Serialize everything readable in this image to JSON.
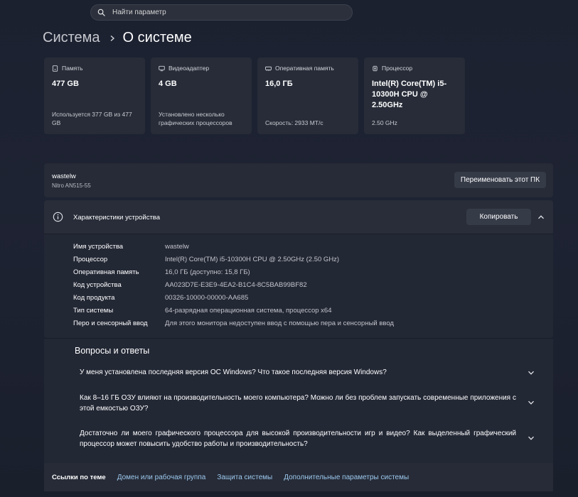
{
  "search": {
    "placeholder": "Найти параметр"
  },
  "breadcrumb": {
    "parent": "Система",
    "current": "О системе"
  },
  "cards": [
    {
      "icon": "storage-icon",
      "title": "Память",
      "value": "477 GB",
      "subtitle": "Используется 377 GB из 477 GB"
    },
    {
      "icon": "display-adapter-icon",
      "title": "Видеоадаптер",
      "value": "4 GB",
      "subtitle": "Установлено несколько графических процессоров"
    },
    {
      "icon": "ram-icon",
      "title": "Оперативная память",
      "value": "16,0 ГБ",
      "subtitle": "Скорость: 2933 МТ/с"
    },
    {
      "icon": "processor-icon",
      "title": "Процессор",
      "value": "Intel(R) Core(TM) i5-10300H CPU @ 2.50GHz",
      "subtitle": "2.50 GHz"
    }
  ],
  "device": {
    "name": "wastelw",
    "model": "Nitro AN515-55",
    "rename_label": "Переименовать этот ПК"
  },
  "specs": {
    "title": "Характеристики устройства",
    "copy_label": "Копировать",
    "rows": [
      {
        "label": "Имя устройства",
        "value": "wastelw"
      },
      {
        "label": "Процессор",
        "value": "Intel(R) Core(TM) i5-10300H CPU @ 2.50GHz (2.50 GHz)"
      },
      {
        "label": "Оперативная память",
        "value": "16,0 ГБ (доступно: 15,8 ГБ)"
      },
      {
        "label": "Код устройства",
        "value": "AA023D7E-E3E9-4EA2-B1C4-8C5BAB99BF82"
      },
      {
        "label": "Код продукта",
        "value": "00326-10000-00000-AA685"
      },
      {
        "label": "Тип системы",
        "value": "64-разрядная операционная система, процессор x64"
      },
      {
        "label": "Перо и сенсорный ввод",
        "value": "Для этого монитора недоступен ввод с помощью пера и сенсорный ввод"
      }
    ]
  },
  "faq": {
    "title": "Вопросы и ответы",
    "items": [
      {
        "question": "У меня установлена последняя версия ОС Windows? Что такое последняя версия Windows?"
      },
      {
        "question": "Как 8–16 ГБ ОЗУ влияют на производительность моего компьютера? Можно ли без проблем запускать современные приложения с этой емкостью ОЗУ?"
      },
      {
        "question": "Достаточно ли моего графического процессора для высокой производительности игр и видео? Как выделенный графический процессор может повысить удобство работы и производительность?"
      }
    ]
  },
  "related": {
    "label": "Ссылки по теме",
    "links": [
      "Домен или рабочая группа",
      "Защита системы",
      "Дополнительные параметры системы"
    ]
  },
  "colors": {
    "accent_link": "#9ec9ee",
    "background": "#1c2130",
    "card": "#272c38"
  }
}
